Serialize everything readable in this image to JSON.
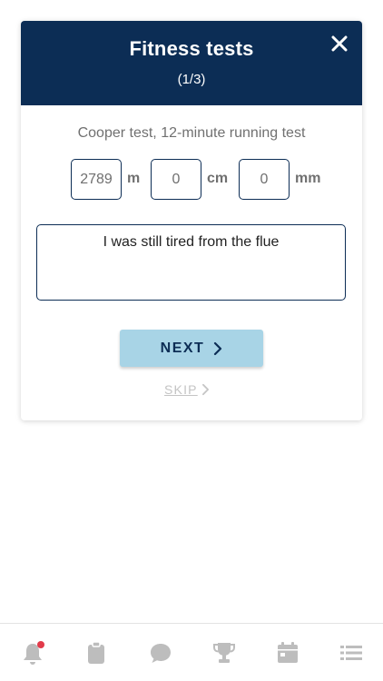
{
  "header": {
    "title": "Fitness tests",
    "progress": "(1/3)"
  },
  "test": {
    "name": "Cooper test, 12-minute running test",
    "fields": [
      {
        "value": "2789",
        "unit": "m"
      },
      {
        "value": "0",
        "unit": "cm"
      },
      {
        "value": "0",
        "unit": "mm"
      }
    ],
    "comment": "I was still tired from the flue"
  },
  "actions": {
    "next_label": "NEXT",
    "skip_label": "SKIP"
  },
  "tabbar": {
    "items": [
      {
        "icon": "bell-icon",
        "badge": true
      },
      {
        "icon": "clipboard-icon"
      },
      {
        "icon": "chat-icon"
      },
      {
        "icon": "trophy-icon"
      },
      {
        "icon": "calendar-icon"
      },
      {
        "icon": "list-icon"
      }
    ]
  },
  "colors": {
    "header_bg": "#0c2d55",
    "next_bg": "#a8d4e6",
    "badge": "#e23b4a",
    "icon_gray": "#bdbdbd"
  }
}
